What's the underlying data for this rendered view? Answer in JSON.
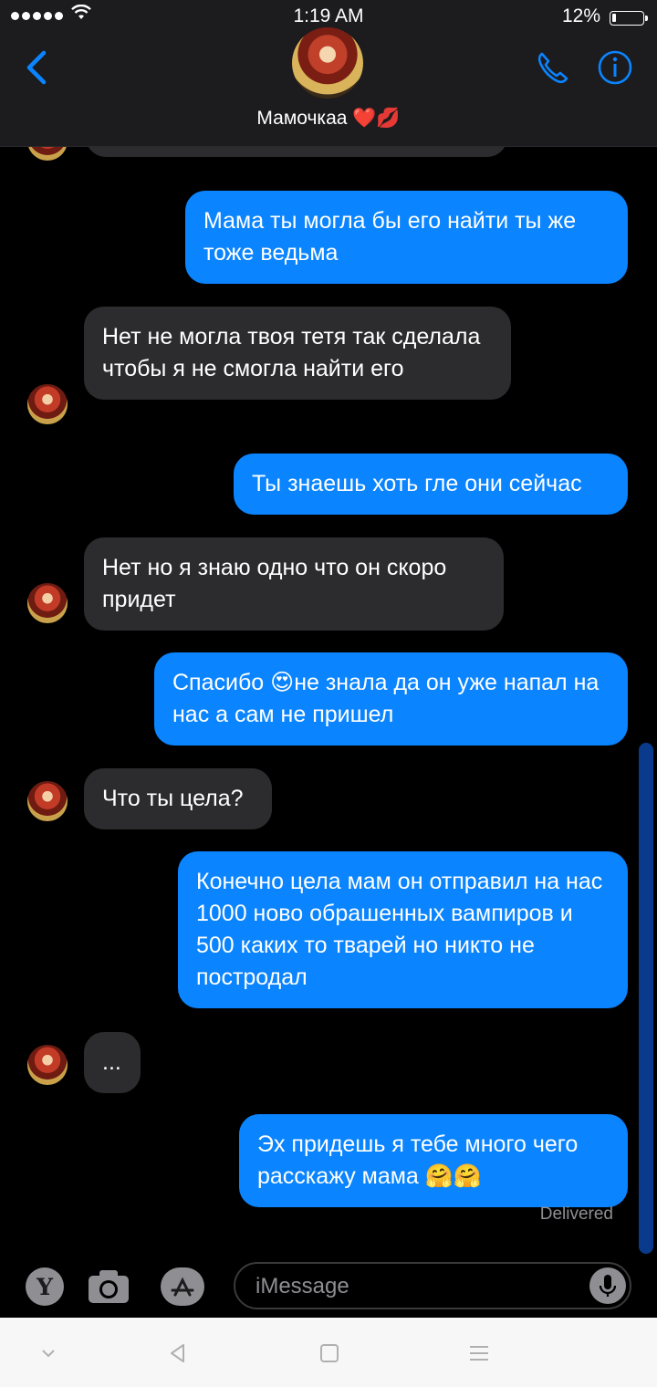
{
  "status_bar": {
    "time": "1:19 AM",
    "battery": "12%",
    "battery_level": 0.12
  },
  "header": {
    "contact_name": "Мамочкаа ❤️💋"
  },
  "messages": [
    {
      "dir": "out",
      "text": "Мама ты могла бы его найти ты же тоже ведьма"
    },
    {
      "dir": "in",
      "text": "Нет не могла твоя тетя так сделала чтобы я не смогла найти его"
    },
    {
      "dir": "out",
      "text": "Ты знаешь хоть гле они сейчас"
    },
    {
      "dir": "in",
      "text": "Нет но я знаю одно что он скоро придет"
    },
    {
      "dir": "out",
      "text": "Спасибо 😍не знала да он уже напал на нас а сам не пришел"
    },
    {
      "dir": "in",
      "text": "Что ты цела?"
    },
    {
      "dir": "out",
      "text": "Конечно цела мам он отправил на нас 1000 ново обрашенных вампиров и 500 каких то тварей но никто не постродал"
    },
    {
      "dir": "in",
      "text": "..."
    },
    {
      "dir": "out",
      "text": "Эх придешь я тебе много чего расскажу мама 🤗🤗"
    }
  ],
  "delivered_label": "Delivered",
  "composer": {
    "placeholder": "iMessage"
  },
  "icons": {
    "back": "chevron-left-icon",
    "call": "phone-icon",
    "info": "info-icon",
    "y_app": "Y",
    "camera": "camera-icon",
    "appstore": "app-store-icon",
    "mic": "microphone-icon"
  },
  "colors": {
    "outgoing": "#0a84ff",
    "incoming": "#2c2c2e",
    "accent": "#0a84ff"
  }
}
